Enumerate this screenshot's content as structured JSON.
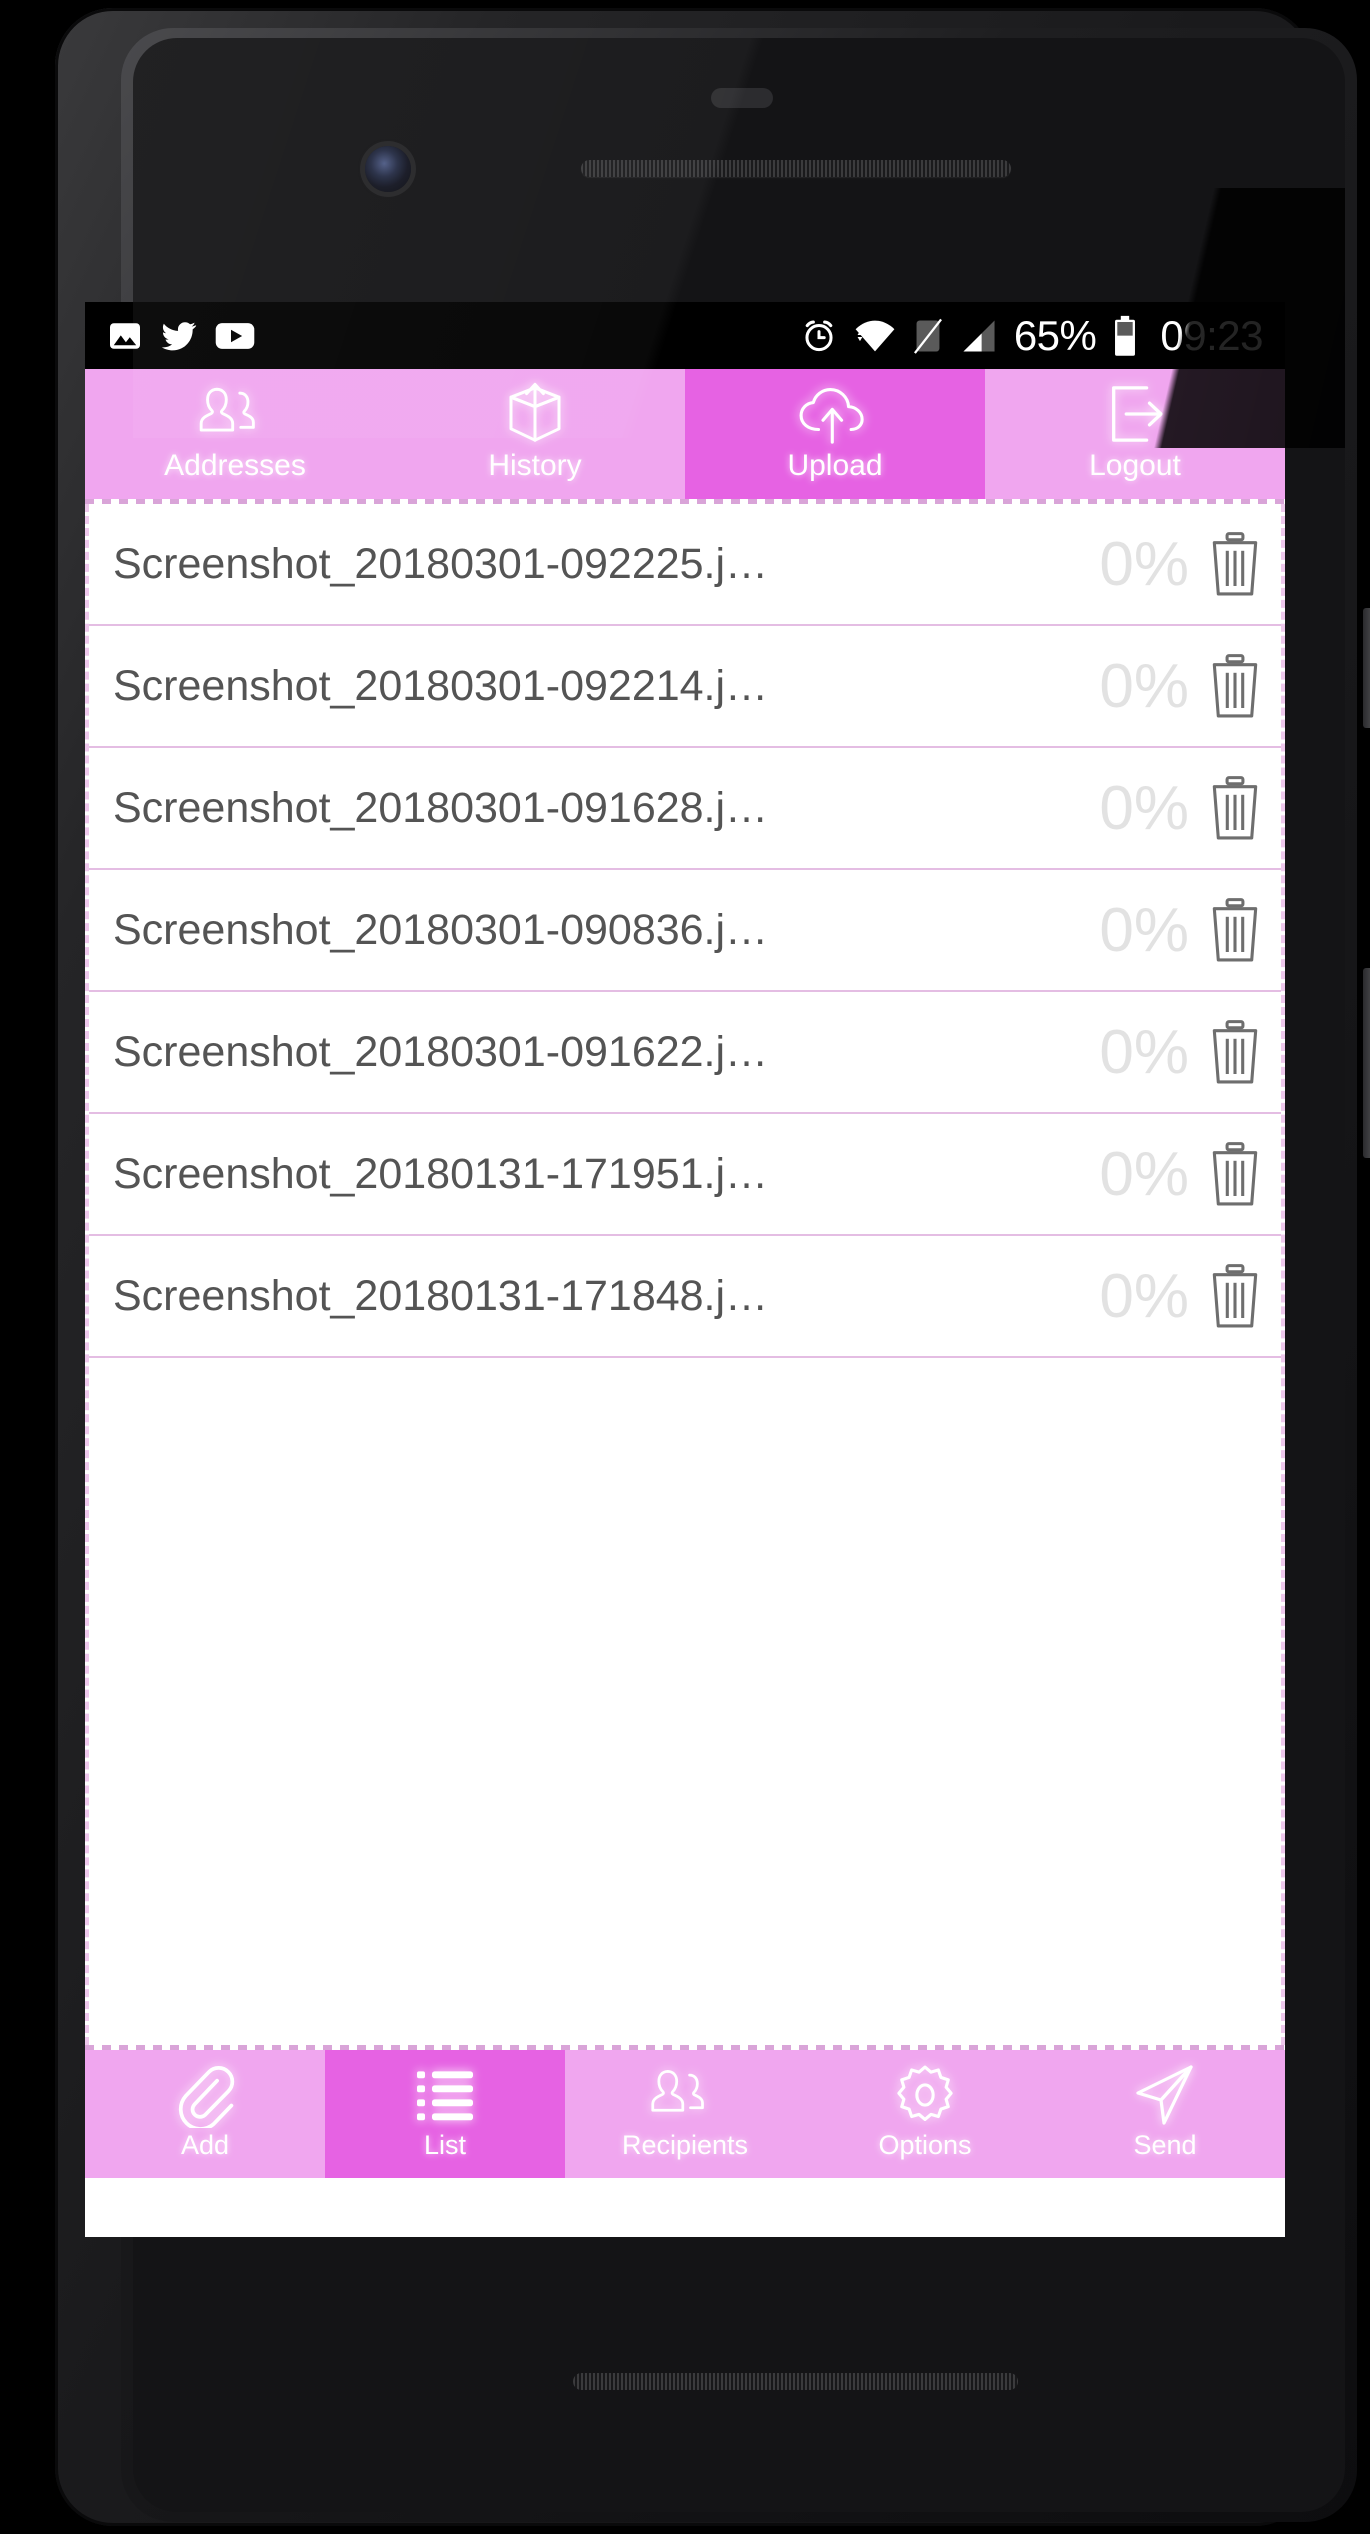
{
  "status_bar": {
    "left_icons": [
      "gallery-image-icon",
      "twitter-icon",
      "youtube-icon"
    ],
    "right_icons": [
      "alarm-icon",
      "wifi-icon",
      "no-sim-icon",
      "cellular-signal-icon",
      "battery-icon"
    ],
    "battery_percent": "65%",
    "clock": "09:23"
  },
  "top_tabs": [
    {
      "label": "Addresses",
      "icon": "contacts-icon",
      "selected": false
    },
    {
      "label": "History",
      "icon": "box-upload-icon",
      "selected": false
    },
    {
      "label": "Upload",
      "icon": "cloud-upload-icon",
      "selected": true
    },
    {
      "label": "Logout",
      "icon": "logout-icon",
      "selected": false
    }
  ],
  "file_list": {
    "rows": [
      {
        "name": "Screenshot_20180301-092225.j…",
        "progress": "0%",
        "delete_icon": "trash-icon"
      },
      {
        "name": "Screenshot_20180301-092214.j…",
        "progress": "0%",
        "delete_icon": "trash-icon"
      },
      {
        "name": "Screenshot_20180301-091628.j…",
        "progress": "0%",
        "delete_icon": "trash-icon"
      },
      {
        "name": "Screenshot_20180301-090836.j…",
        "progress": "0%",
        "delete_icon": "trash-icon"
      },
      {
        "name": "Screenshot_20180301-091622.j…",
        "progress": "0%",
        "delete_icon": "trash-icon"
      },
      {
        "name": "Screenshot_20180131-171951.j…",
        "progress": "0%",
        "delete_icon": "trash-icon"
      },
      {
        "name": "Screenshot_20180131-171848.j…",
        "progress": "0%",
        "delete_icon": "trash-icon"
      }
    ]
  },
  "bottom_tabs": [
    {
      "label": "Add",
      "icon": "paperclip-icon",
      "selected": false
    },
    {
      "label": "List",
      "icon": "list-icon",
      "selected": true
    },
    {
      "label": "Recipients",
      "icon": "contacts-icon",
      "selected": false
    },
    {
      "label": "Options",
      "icon": "gear-icon",
      "selected": false
    },
    {
      "label": "Send",
      "icon": "send-plane-icon",
      "selected": false
    }
  ],
  "colors": {
    "accent_light": "#f0a6ef",
    "accent_selected": "#e662e3",
    "row_divider": "#e4bde3",
    "filename_text": "#545454",
    "progress_text": "#e2e2e2",
    "status_bar_bg": "#000000"
  }
}
